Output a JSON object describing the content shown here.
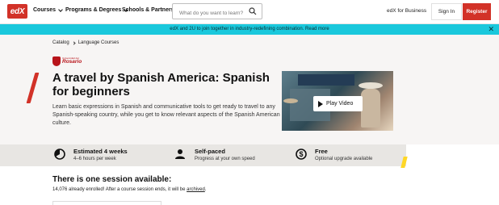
{
  "header": {
    "logo_text": "edX",
    "nav": [
      "Courses",
      "Programs & Degrees",
      "Schools & Partners"
    ],
    "search_placeholder": "What do you want to learn?",
    "business_link": "edX for Business",
    "signin_label": "Sign In",
    "register_label": "Register"
  },
  "banner": {
    "text": "edX and 2U to join together in industry-redefining combination. Read more",
    "close_icon": "close-icon"
  },
  "hero": {
    "breadcrumb": [
      "Catalog",
      "Language Courses"
    ],
    "university_small": "Universidad del",
    "university_name": "Rosario",
    "title": "A travel by Spanish America: Spanish for beginners",
    "description": "Learn basic expressions in Spanish and communicative tools to get ready to travel to any Spanish-speaking country, while you get to know relevant aspects of the Spanish American culture.",
    "play_label": "Play Video"
  },
  "stats": [
    {
      "icon": "clock-icon",
      "title": "Estimated 4 weeks",
      "sub": "4–6 hours per week"
    },
    {
      "icon": "person-icon",
      "title": "Self-paced",
      "sub": "Progress at your own speed"
    },
    {
      "icon": "dollar-icon",
      "title": "Free",
      "sub": "Optional upgrade available"
    }
  ],
  "sessions": {
    "title": "There is one session available:",
    "enrolled_text": "14,076 already enrolled! After a course session ends, it will be",
    "archived_link": "archived",
    "enrolled_suffix": "."
  },
  "colors": {
    "brand_red": "#d23228",
    "banner_teal": "#1ac8dc",
    "accent_yellow": "#ffd726"
  }
}
